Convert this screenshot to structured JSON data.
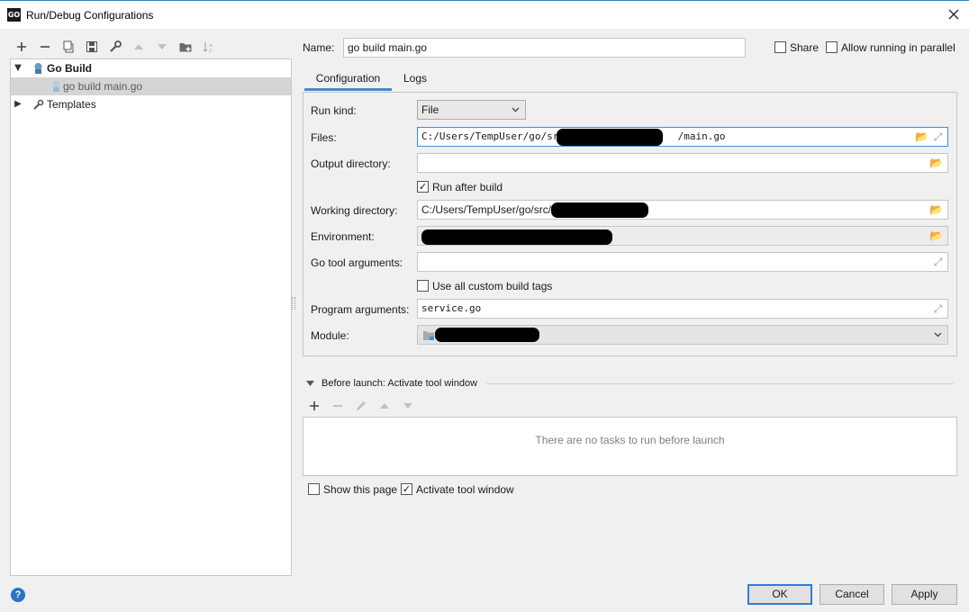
{
  "window": {
    "title": "Run/Debug Configurations",
    "app_icon_text": "GO"
  },
  "toolbar": {
    "icons": [
      "plus-icon",
      "minus-icon",
      "copy-icon",
      "save-icon",
      "wrench-icon",
      "arrow-up-icon",
      "arrow-down-icon",
      "folder-add-icon",
      "sort-icon"
    ]
  },
  "tree": {
    "items": [
      {
        "label": "Go Build"
      },
      {
        "label": "go build main.go"
      },
      {
        "label": "Templates"
      }
    ]
  },
  "form": {
    "name_label": "Name:",
    "name_value": "go build main.go",
    "share_label": "Share",
    "allow_parallel_label": "Allow running in parallel",
    "tabs": [
      {
        "label": "Configuration"
      },
      {
        "label": "Logs"
      }
    ],
    "run_kind_label": "Run kind:",
    "run_kind_value": "File",
    "files_label": "Files:",
    "files_value_prefix": "C:/Users/TempUser/go/src/",
    "files_value_suffix": "/main.go",
    "output_dir_label": "Output directory:",
    "output_dir_value": "",
    "run_after_build_label": "Run after build",
    "working_dir_label": "Working directory:",
    "working_dir_value": "C:/Users/TempUser/go/src/",
    "environment_label": "Environment:",
    "go_tool_args_label": "Go tool arguments:",
    "go_tool_args_value": "",
    "custom_tags_label": "Use all custom build tags",
    "program_args_label": "Program arguments:",
    "program_args_value": "service.go",
    "module_label": "Module:"
  },
  "before_launch": {
    "title": "Before launch: Activate tool window",
    "empty_text": "There are no tasks to run before launch",
    "show_page_label": "Show this page",
    "activate_tool_label": "Activate tool window"
  },
  "buttons": {
    "ok": "OK",
    "cancel": "Cancel",
    "apply": "Apply",
    "help": "?"
  }
}
